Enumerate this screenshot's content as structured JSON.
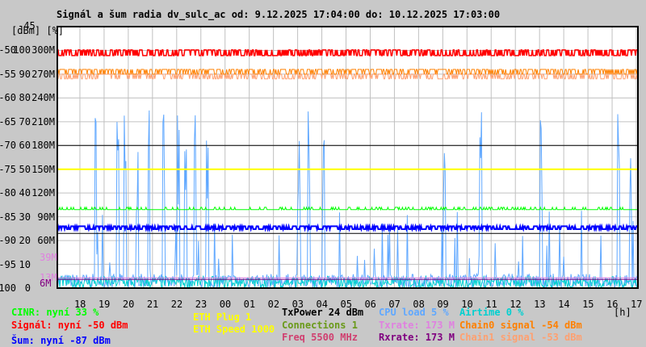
{
  "title": "Signál a šum radia dv_sulc_ac od: 9.12.2025 17:04:00 do: 10.12.2025 17:03:00",
  "chart_data": {
    "type": "line",
    "title": "Signál a šum radia dv_sulc_ac od: 9.12.2025 17:04:00 do: 10.12.2025 17:03:00",
    "xlabel": "[h]",
    "ylabel": "[dBm] [%]",
    "ylim": [
      -100,
      -45
    ],
    "y_top_label": "-45",
    "y_ticks": [
      {
        "dbm": "-50",
        "pct": "100",
        "rate": "300M"
      },
      {
        "dbm": "-55",
        "pct": "90",
        "rate": "270M"
      },
      {
        "dbm": "-60",
        "pct": "80",
        "rate": "240M"
      },
      {
        "dbm": "-65",
        "pct": "70",
        "rate": "210M"
      },
      {
        "dbm": "-70",
        "pct": "60",
        "rate": "180M"
      },
      {
        "dbm": "-75",
        "pct": "50",
        "rate": "150M"
      },
      {
        "dbm": "-80",
        "pct": "40",
        "rate": "120M"
      },
      {
        "dbm": "-85",
        "pct": "30",
        "rate": "90M"
      },
      {
        "dbm": "-90",
        "pct": "20",
        "rate": "60M"
      },
      {
        "dbm": "-95",
        "pct": "10",
        "rate": ""
      },
      {
        "dbm": "-100",
        "pct": "0",
        "rate": ""
      }
    ],
    "extra_rate_labels": [
      {
        "label": "39M",
        "color": "#e080e0",
        "value": 39
      },
      {
        "label": "13M",
        "color": "#e080e0",
        "value": 13
      },
      {
        "label": "6M",
        "color": "#800080",
        "value": 6
      }
    ],
    "x_ticks": [
      "18",
      "19",
      "20",
      "21",
      "22",
      "23",
      "00",
      "01",
      "02",
      "03",
      "04",
      "05",
      "06",
      "07",
      "08",
      "09",
      "10",
      "11",
      "12",
      "13",
      "14",
      "15",
      "16",
      "17"
    ],
    "grid": true,
    "series": [
      {
        "name": "Signál",
        "color": "#ff0000",
        "level": -50.5
      },
      {
        "name": "Chain0 signal",
        "color": "#ff8000",
        "level": -54
      },
      {
        "name": "Chain1 signal",
        "color": "#ffa070",
        "level": -53.5
      },
      {
        "name": "Šum",
        "color": "#0000ff",
        "level": -87
      },
      {
        "name": "CINR",
        "color": "#00ff00",
        "level_pct": 33
      },
      {
        "name": "CPU load",
        "color": "#60a8ff",
        "level_pct": 5
      },
      {
        "name": "Airtime",
        "color": "#00d0d0",
        "level_pct": 0
      },
      {
        "name": "TxPower",
        "color": "#000000",
        "level_dbm": -70
      },
      {
        "name": "ETH Speed",
        "color": "#ffff00",
        "level_pct": 50
      }
    ],
    "cpu_spikes_hours": [
      1.6,
      2.5,
      2.8,
      3.3,
      3.8,
      4.4,
      5.0,
      5.3,
      5.7,
      6.2,
      10.0,
      10.4,
      11.0,
      16.0,
      17.5,
      20.0,
      23.2,
      23.7
    ]
  },
  "legend": {
    "cinr": "CINR: nyní 33 %",
    "signal": "Signál: nyní -50 dBm",
    "noise": "Šum: nyní -87 dBm",
    "eth_plug": "ETH Plug 1",
    "eth_speed": "ETH Speed 1000",
    "txpower": "TxPower 24 dBm",
    "connections": "Connections 1",
    "freq": "Freq 5500 MHz",
    "cpu": "CPU load 5 %",
    "txrate": "Txrate: 173 M",
    "rxrate": "Rxrate: 173 M",
    "airtime": "Airtime 0 %",
    "chain0": "Chain0 signal -54 dBm",
    "chain1": "Chain1 signal -53 dBm"
  },
  "colors": {
    "cinr": "#00ff00",
    "signal": "#ff0000",
    "noise": "#0000ff",
    "eth": "#ffff00",
    "txpower": "#000000",
    "connections": "#6a9a1a",
    "freq": "#d04070",
    "cpu": "#60a8ff",
    "txrate": "#e080e0",
    "rxrate": "#800080",
    "airtime": "#00d0d0",
    "chain0": "#ff8000",
    "chain1": "#ffa070"
  }
}
